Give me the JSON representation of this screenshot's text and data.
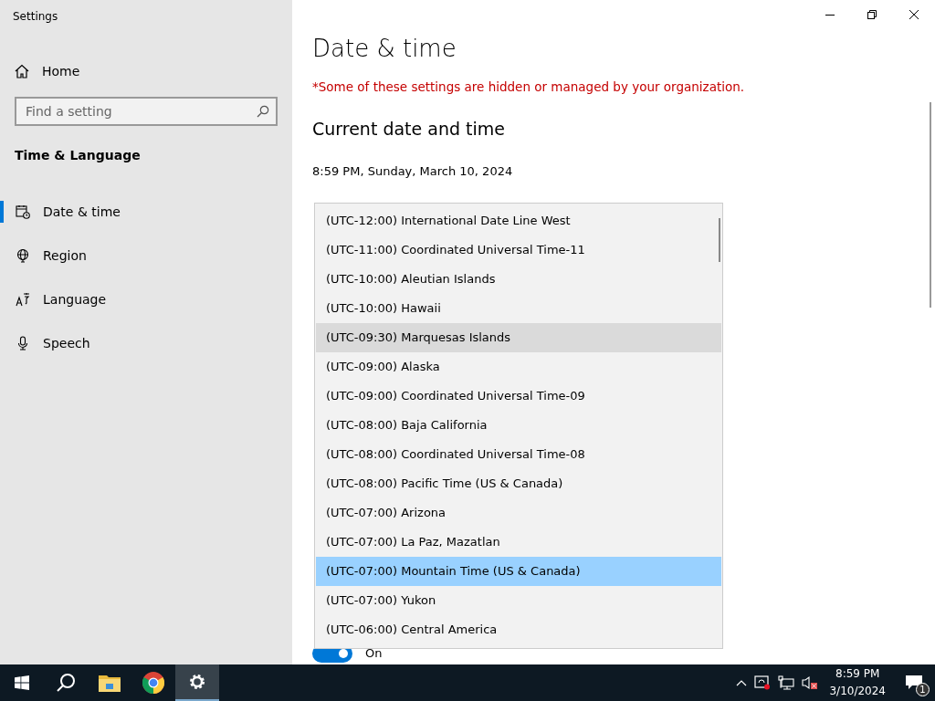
{
  "window": {
    "title": "Settings"
  },
  "sidebar": {
    "home": "Home",
    "search": {
      "placeholder": "Find a setting"
    },
    "section": "Time & Language",
    "items": [
      {
        "label": "Date & time",
        "selected": true
      },
      {
        "label": "Region",
        "selected": false
      },
      {
        "label": "Language",
        "selected": false
      },
      {
        "label": "Speech",
        "selected": false
      }
    ]
  },
  "main": {
    "title": "Date & time",
    "notice": "*Some of these settings are hidden or managed by your organization.",
    "heading": "Current date and time",
    "current": "8:59 PM, Sunday, March 10, 2024",
    "toggle": {
      "label": "On",
      "on": true
    },
    "timezones": [
      {
        "label": "(UTC-12:00) International Date Line West",
        "selected": false,
        "hovered": false
      },
      {
        "label": "(UTC-11:00) Coordinated Universal Time-11",
        "selected": false,
        "hovered": false
      },
      {
        "label": "(UTC-10:00) Aleutian Islands",
        "selected": false,
        "hovered": false
      },
      {
        "label": "(UTC-10:00) Hawaii",
        "selected": false,
        "hovered": false
      },
      {
        "label": "(UTC-09:30) Marquesas Islands",
        "selected": false,
        "hovered": true
      },
      {
        "label": "(UTC-09:00) Alaska",
        "selected": false,
        "hovered": false
      },
      {
        "label": "(UTC-09:00) Coordinated Universal Time-09",
        "selected": false,
        "hovered": false
      },
      {
        "label": "(UTC-08:00) Baja California",
        "selected": false,
        "hovered": false
      },
      {
        "label": "(UTC-08:00) Coordinated Universal Time-08",
        "selected": false,
        "hovered": false
      },
      {
        "label": "(UTC-08:00) Pacific Time (US & Canada)",
        "selected": false,
        "hovered": false
      },
      {
        "label": "(UTC-07:00) Arizona",
        "selected": false,
        "hovered": false
      },
      {
        "label": "(UTC-07:00) La Paz, Mazatlan",
        "selected": false,
        "hovered": false
      },
      {
        "label": "(UTC-07:00) Mountain Time (US & Canada)",
        "selected": true,
        "hovered": false
      },
      {
        "label": "(UTC-07:00) Yukon",
        "selected": false,
        "hovered": false
      },
      {
        "label": "(UTC-06:00) Central America",
        "selected": false,
        "hovered": false
      }
    ]
  },
  "taskbar": {
    "apps": [
      {
        "active": false
      },
      {
        "active": false
      },
      {
        "active": true
      }
    ],
    "time": "8:59 PM",
    "date": "3/10/2024",
    "notifications": "1"
  }
}
